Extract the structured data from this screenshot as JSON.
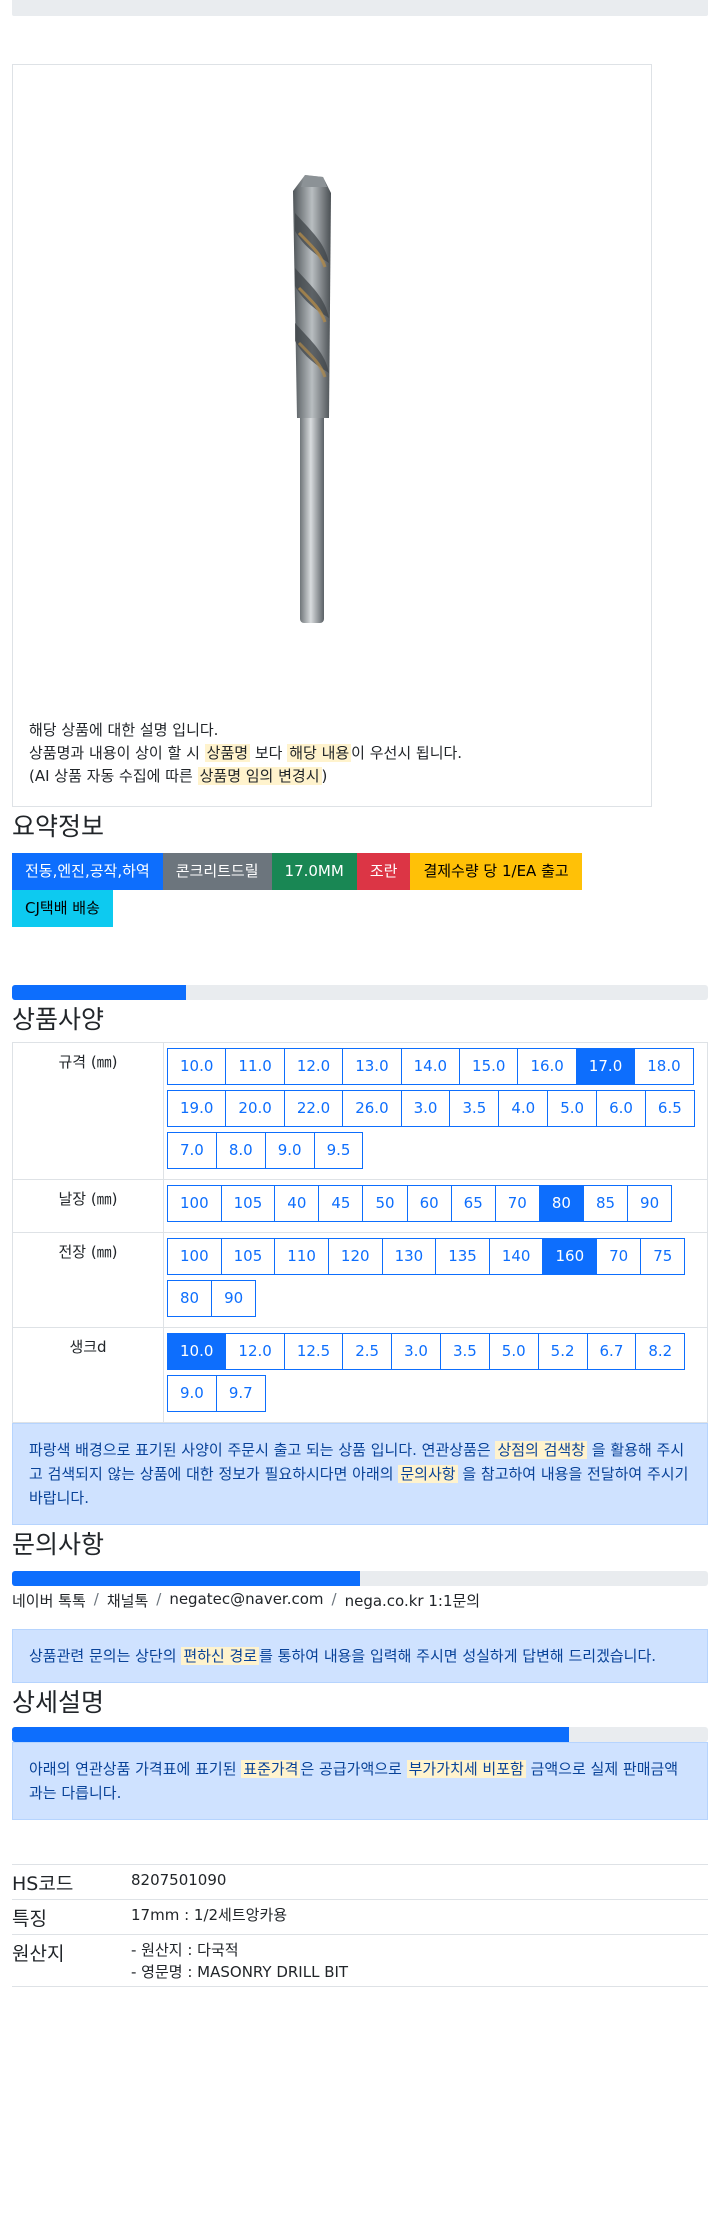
{
  "product": {
    "image_alt": "masonry drill bit",
    "desc_line1": "해당 상품에 대한 설명 입니다.",
    "desc_line2_a": "상품명과 내용이 상이 할 시 ",
    "desc_line2_mark1": "상품명",
    "desc_line2_b": " 보다 ",
    "desc_line2_mark2": "해당 내용",
    "desc_line2_c": "이 우선시 됩니다.",
    "desc_line3_a": "(AI 상품 자동 수집에 따른 ",
    "desc_line3_mark": "상품명 임의 변경시",
    "desc_line3_b": ")"
  },
  "summary": {
    "title": "요약정보",
    "badges": [
      {
        "label": "전동,엔진,공작,하역",
        "color": "#0d6efd",
        "text": "#ffffff"
      },
      {
        "label": "콘크리트드릴",
        "color": "#6c757d",
        "text": "#ffffff"
      },
      {
        "label": "17.0MM",
        "color": "#198754",
        "text": "#ffffff"
      },
      {
        "label": "조란",
        "color": "#dc3545",
        "text": "#ffffff"
      },
      {
        "label": "결제수량 당 1/EA 출고",
        "color": "#ffc107",
        "text": "#000000"
      },
      {
        "label": "CJ택배 배송",
        "color": "#0dcaf0",
        "text": "#000000"
      }
    ]
  },
  "specs": {
    "progress_pct": 25,
    "title": "상품사양",
    "rows": [
      {
        "label": "규격 (㎜)",
        "options": [
          "10.0",
          "11.0",
          "12.0",
          "13.0",
          "14.0",
          "15.0",
          "16.0",
          "17.0",
          "18.0",
          "19.0",
          "20.0",
          "22.0",
          "26.0",
          "3.0",
          "3.5",
          "4.0",
          "5.0",
          "6.0",
          "6.5",
          "7.0",
          "8.0",
          "9.0",
          "9.5"
        ],
        "selected": "17.0"
      },
      {
        "label": "날장 (㎜)",
        "options": [
          "100",
          "105",
          "40",
          "45",
          "50",
          "60",
          "65",
          "70",
          "80",
          "85",
          "90"
        ],
        "selected": "80"
      },
      {
        "label": "전장 (㎜)",
        "options": [
          "100",
          "105",
          "110",
          "120",
          "130",
          "135",
          "140",
          "160",
          "70",
          "75",
          "80",
          "90"
        ],
        "selected": "160"
      },
      {
        "label": "생크d",
        "options": [
          "10.0",
          "12.0",
          "12.5",
          "2.5",
          "3.0",
          "3.5",
          "5.0",
          "5.2",
          "6.7",
          "8.2",
          "9.0",
          "9.7"
        ],
        "selected": "10.0"
      }
    ],
    "notice_a": "파랑색 배경으로 표기된 사양이 주문시 출고 되는 상품 입니다. 연관상품은 ",
    "notice_mark1": "상점의 검색창",
    "notice_b": " 을 활용해 주시고 검색되지 않는 상품에 대한 정보가 필요하시다면 아래의 ",
    "notice_mark2": "문의사항",
    "notice_c": " 을 참고하여 내용을 전달하여 주시기 바랍니다."
  },
  "inquiry": {
    "title": "문의사항",
    "progress_pct": 50,
    "links": [
      "네이버 톡톡",
      "채널톡",
      "negatec@naver.com",
      "nega.co.kr 1:1문의"
    ],
    "separator": "/",
    "notice_a": "상품관련 문의는 상단의 ",
    "notice_mark": "편하신 경로",
    "notice_b": "를 통하여 내용을 입력해 주시면 성실하게 답변해 드리겠습니다."
  },
  "detail": {
    "title": "상세설명",
    "progress_pct": 80,
    "notice_a": "아래의 연관상품 가격표에 표기된 ",
    "notice_mark1": "표준가격",
    "notice_b": "은 공급가액으로 ",
    "notice_mark2": "부가가치세 비포함",
    "notice_c": " 금액으로 실제 판매금액과는 다릅니다.",
    "info": [
      {
        "key": "HS코드",
        "lines": [
          "8207501090"
        ]
      },
      {
        "key": "특징",
        "lines": [
          "17mm : 1/2세트앙카용"
        ]
      },
      {
        "key": "원산지",
        "lines": [
          "- 원산지 : 다국적",
          "- 영문명 : MASONRY DRILL BIT"
        ]
      }
    ]
  }
}
